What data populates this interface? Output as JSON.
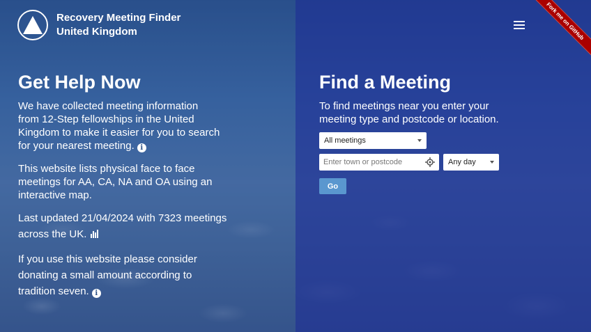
{
  "brand": {
    "line1": "Recovery Meeting Finder",
    "line2": "United Kingdom"
  },
  "ribbon": {
    "text": "Fork me on GitHub"
  },
  "menu": {
    "icon": "hamburger-menu-icon"
  },
  "left": {
    "title": "Get Help Now",
    "p1": "We have collected meeting information from 12-Step fellowships in the United Kingdom to make it easier for you to search for your nearest meeting.",
    "p2": "This website lists physical face to face meetings for AA, CA, NA and OA using an interactive map.",
    "p3": "Last updated 21/04/2024 with 7323 meetings across the UK.",
    "p4": "If you use this website please consider donating a small amount according to tradition seven."
  },
  "right": {
    "title": "Find a Meeting",
    "intro": "To find meetings near you enter your meeting type and postcode or location.",
    "meeting_select": "All meetings",
    "location_placeholder": "Enter town or postcode",
    "day_select": "Any day",
    "go_label": "Go"
  },
  "colors": {
    "ribbon": "#aa0000",
    "go_button": "#5a97cf",
    "right_panel": "#1e3296"
  }
}
